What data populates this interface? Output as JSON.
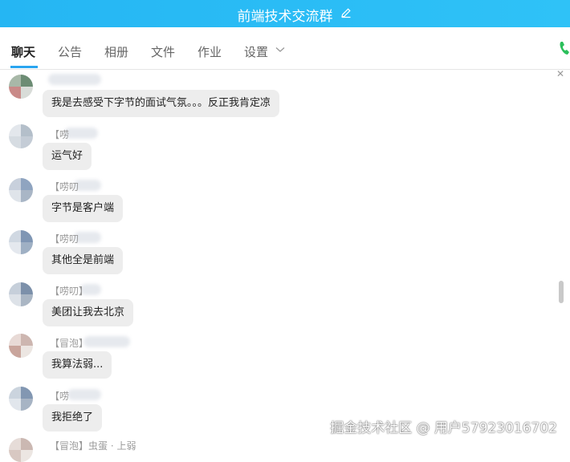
{
  "window": {
    "title": "前端技术交流群"
  },
  "tabs": [
    {
      "label": "聊天",
      "active": true
    },
    {
      "label": "公告",
      "active": false
    },
    {
      "label": "相册",
      "active": false
    },
    {
      "label": "文件",
      "active": false
    },
    {
      "label": "作业",
      "active": false
    },
    {
      "label": "设置",
      "active": false
    }
  ],
  "messages": [
    {
      "sender": "",
      "text": "我是去感受下字节的面试气氛。。。反正我肯定凉"
    },
    {
      "sender": "【唠",
      "text": "运气好"
    },
    {
      "sender": "【唠叨",
      "text": "字节是客户端"
    },
    {
      "sender": "【唠叨",
      "text": "其他全是前端"
    },
    {
      "sender": "【唠叨】",
      "text": "美团让我去北京"
    },
    {
      "sender": "【冒泡】",
      "text": "我算法弱..."
    },
    {
      "sender": "【唠",
      "text": "我拒绝了"
    },
    {
      "sender": "【冒泡】虫蛋 · 上弱",
      "text": ""
    }
  ],
  "watermark": "掘金技术社区 @ 用户57923016702",
  "colors": {
    "header": "#2ab8f4",
    "active_tab_underline": "#2aa5f0",
    "bubble": "#ededed",
    "phone": "#2bbf5b"
  },
  "icons": {
    "edit": "edit-icon",
    "dropdown": "chevron-down-icon",
    "call": "phone-icon",
    "close": "close-icon"
  }
}
